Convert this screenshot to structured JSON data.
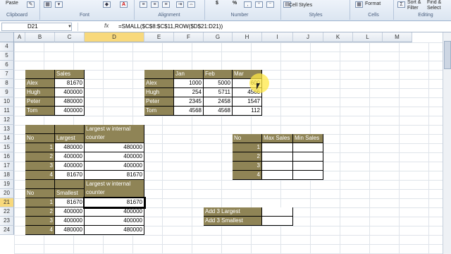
{
  "ribbon": {
    "paste": "Paste",
    "groups": [
      "Clipboard",
      "Font",
      "Alignment",
      "Number",
      "Styles",
      "Cells",
      "Editing"
    ],
    "cell_styles": "Cell Styles",
    "format": "Format",
    "sort": "Sort &",
    "filter": "Filter",
    "find": "Find &",
    "select": "Select",
    "currency": "$",
    "percent": "%"
  },
  "formula_bar": {
    "name_box": "D21",
    "fx": "fx",
    "formula": "=SMALL($C$8:$C$11,ROW($D$21:D21))"
  },
  "columns": [
    "A",
    "B",
    "C",
    "D",
    "E",
    "F",
    "G",
    "H",
    "I",
    "J",
    "K",
    "L",
    "M"
  ],
  "rows": [
    "4",
    "5",
    "6",
    "7",
    "8",
    "9",
    "10",
    "11",
    "12",
    "13",
    "14",
    "15",
    "16",
    "17",
    "18",
    "19",
    "20",
    "21",
    "22",
    "23",
    "24"
  ],
  "sales_table": {
    "header": "Sales",
    "names": [
      "Alex",
      "Hugh",
      "Peter",
      "Tom"
    ],
    "values": [
      "81670",
      "400000",
      "480000",
      "400000"
    ]
  },
  "monthly_table": {
    "headers": [
      "Jan",
      "Feb",
      "Mar"
    ],
    "names": [
      "Alex",
      "Hugh",
      "Peter",
      "Tom"
    ],
    "rows": [
      [
        "1000",
        "5000",
        "600"
      ],
      [
        "254",
        "5711",
        "4566"
      ],
      [
        "2345",
        "2458",
        "1547"
      ],
      [
        "4568",
        "4568",
        "112"
      ]
    ]
  },
  "largest_table": {
    "h_no": "No",
    "h_largest": "Largest",
    "h_counter1": "Largest w internal",
    "h_counter2": "counter",
    "rows": [
      [
        "1",
        "480000",
        "480000"
      ],
      [
        "2",
        "400000",
        "400000"
      ],
      [
        "3",
        "400000",
        "400000"
      ],
      [
        "4",
        "81670",
        "81670"
      ]
    ]
  },
  "smallest_table": {
    "h_no": "No",
    "h_smallest": "Smallest",
    "h_counter1": "Largest w internal",
    "h_counter2": "counter",
    "rows": [
      [
        "1",
        "81670",
        "81670"
      ],
      [
        "2",
        "400000",
        "400000"
      ],
      [
        "3",
        "400000",
        "400000"
      ],
      [
        "4",
        "480000",
        "480000"
      ]
    ]
  },
  "maxmin_table": {
    "h_no": "No",
    "h_max": "Max Sales",
    "h_min": "Min Sales",
    "nums": [
      "1",
      "2",
      "3",
      "4"
    ]
  },
  "add_table": {
    "largest": "Add 3 Largest",
    "smallest": "Add 3 Smallest"
  }
}
